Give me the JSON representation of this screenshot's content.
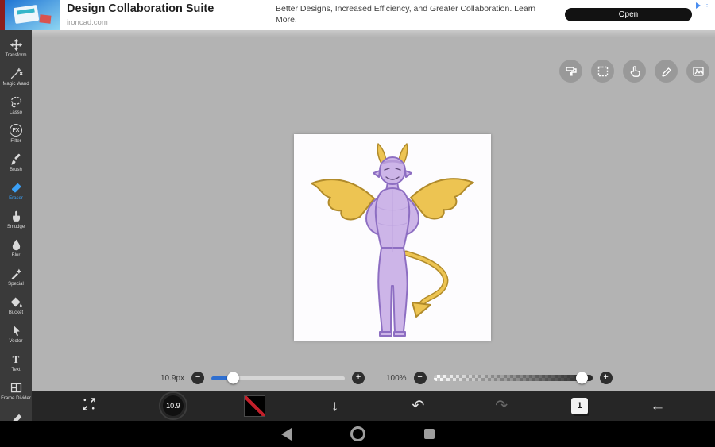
{
  "ad": {
    "title": "Design Collaboration Suite",
    "domain": "ironcad.com",
    "body": "Better Designs, Increased Efficiency, and Greater Collaboration. Learn More.",
    "cta": "Open"
  },
  "sidebar": {
    "items": [
      {
        "label": "Transform",
        "icon": "transform-icon",
        "active": false
      },
      {
        "label": "Magic Wand",
        "icon": "magic-wand-icon",
        "active": false
      },
      {
        "label": "Lasso",
        "icon": "lasso-icon",
        "active": false
      },
      {
        "label": "Filter",
        "icon": "filter-fx-icon",
        "active": false
      },
      {
        "label": "Brush",
        "icon": "brush-icon",
        "active": false
      },
      {
        "label": "Eraser",
        "icon": "eraser-icon",
        "active": true
      },
      {
        "label": "Smudge",
        "icon": "smudge-icon",
        "active": false
      },
      {
        "label": "Blur",
        "icon": "blur-icon",
        "active": false
      },
      {
        "label": "Special",
        "icon": "special-icon",
        "active": false
      },
      {
        "label": "Bucket",
        "icon": "bucket-icon",
        "active": false
      },
      {
        "label": "Vector",
        "icon": "vector-icon",
        "active": false
      },
      {
        "label": "Text",
        "icon": "text-icon",
        "active": false
      },
      {
        "label": "Frame Divider",
        "icon": "frame-divider-icon",
        "active": false
      }
    ]
  },
  "canvas_tools": [
    "roller-icon",
    "select-marquee-icon",
    "hand-gesture-icon",
    "pencil-icon",
    "image-material-icon"
  ],
  "sliders": {
    "brush_size": {
      "label": "10.9px",
      "percent": 16
    },
    "opacity": {
      "label": "100%",
      "percent": 93
    }
  },
  "bottom_bar": {
    "brush_size": "10.9",
    "layer": "1"
  },
  "icons": {
    "minus": "−",
    "plus": "+",
    "down_arrow": "↓",
    "undo": "↶",
    "redo": "↷",
    "back": "←",
    "fx": "FX",
    "text_tool": "T"
  },
  "colors": {
    "accent_active_tool": "#3ba0f6",
    "slider_fill": "#2f6fd0",
    "cta_background": "#121212",
    "canvas_background": "#b3b3b3"
  }
}
